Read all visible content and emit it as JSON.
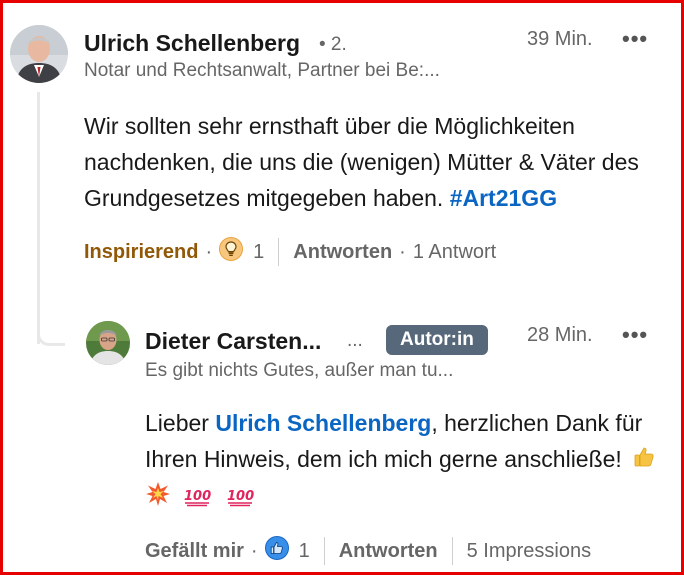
{
  "comment": {
    "author_name": "Ulrich Schellenberg",
    "degree": "• 2.",
    "headline": "Notar und Rechtsanwalt, Partner bei Be:...",
    "time": "39 Min.",
    "more_label": "•••",
    "text_before_hashtag": "Wir sollten sehr ernsthaft über die Möglichkeiten nachdenken, die uns die (wenigen) Mütter & Väter des Grundgesetzes mitgegeben haben.",
    "hashtag": "#Art21GG",
    "reaction_label": "Inspirierend",
    "reaction_icon": "lightbulb-icon",
    "reaction_count": "1",
    "reply_label": "Antworten",
    "reply_count_text": "1 Antwort",
    "colors": {
      "reaction": "#915907",
      "link": "#0a66c2"
    }
  },
  "reply": {
    "author_name": "Dieter Carsten...",
    "name_more": "...",
    "badge": "Autor:in",
    "time": "28 Min.",
    "more_label": "•••",
    "headline": "Es gibt nichts Gutes, außer man tu...",
    "text_prefix": "Lieber ",
    "mention": "Ulrich Schellenberg",
    "text_suffix": ", herzlichen Dank für Ihren Hinweis, dem ich mich gerne anschließe!",
    "emojis": [
      "thumbs-up-icon",
      "collision-icon",
      "hundred-points-icon",
      "hundred-points-icon"
    ],
    "like_label": "Gefällt mir",
    "like_icon": "like-icon",
    "like_count": "1",
    "reply_label": "Antworten",
    "impressions": "5 Impressions",
    "colors": {
      "badge_bg": "#56687a"
    }
  }
}
